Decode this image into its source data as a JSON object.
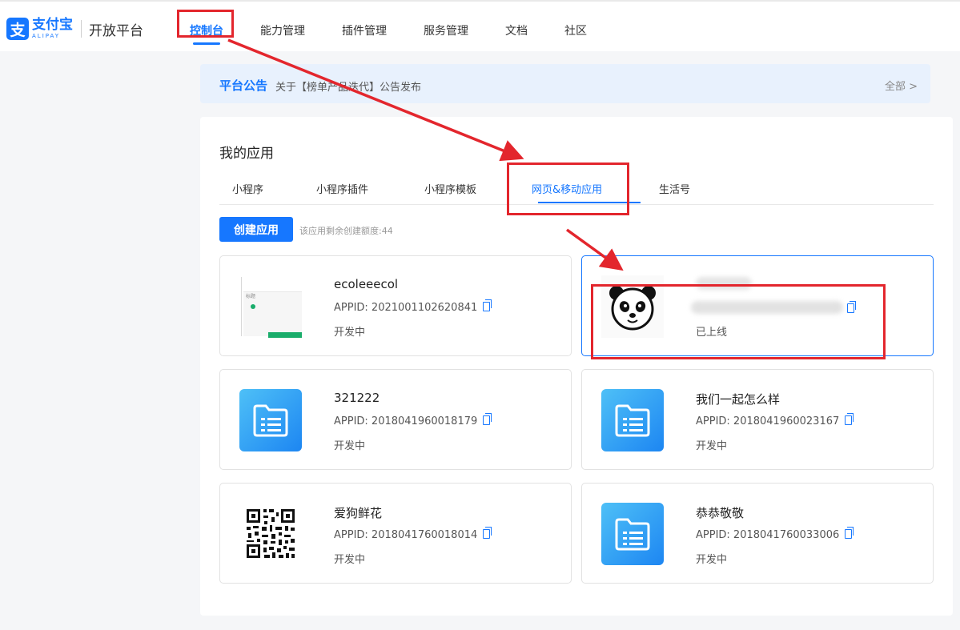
{
  "header": {
    "logo_mark": "支",
    "logo_cn": "支付宝",
    "logo_en": "ALIPAY",
    "platform": "开放平台",
    "nav": [
      "控制台",
      "能力管理",
      "插件管理",
      "服务管理",
      "文档",
      "社区"
    ],
    "active_nav": "控制台"
  },
  "notice": {
    "title": "平台公告",
    "text": "关于【榜单产品迭代】公告发布",
    "all_link": "全部 >"
  },
  "apps": {
    "title": "我的应用",
    "tabs": [
      "小程序",
      "小程序插件",
      "小程序模板",
      "网页&移动应用",
      "生活号"
    ],
    "active_tab": "网页&移动应用",
    "create_button": "创建应用",
    "quota_text": "该应用剩余创建额度:44",
    "cards": [
      {
        "name": "ecoleeecol",
        "appid": "APPID: 2021001102620841",
        "status": "开发中",
        "thumb": "screenshot",
        "thumb_label": "标题"
      },
      {
        "name": "",
        "appid": "",
        "status": "已上线",
        "thumb": "panda"
      },
      {
        "name": "321222",
        "appid": "APPID: 2018041960018179",
        "status": "开发中",
        "thumb": "folder"
      },
      {
        "name": "我们一起怎么样",
        "appid": "APPID: 2018041960023167",
        "status": "开发中",
        "thumb": "folder"
      },
      {
        "name": "爱狗鲜花",
        "appid": "APPID: 2018041760018014",
        "status": "开发中",
        "thumb": "qrcode"
      },
      {
        "name": "恭恭敬敬",
        "appid": "APPID: 2018041760033006",
        "status": "开发中",
        "thumb": "folder"
      }
    ]
  },
  "colors": {
    "brand": "#1677ff",
    "annotation": "#e3262d",
    "notice_bg": "#e8f1fd"
  },
  "icons": [
    "copy-icon",
    "folder-icon",
    "chevron-right-icon"
  ]
}
